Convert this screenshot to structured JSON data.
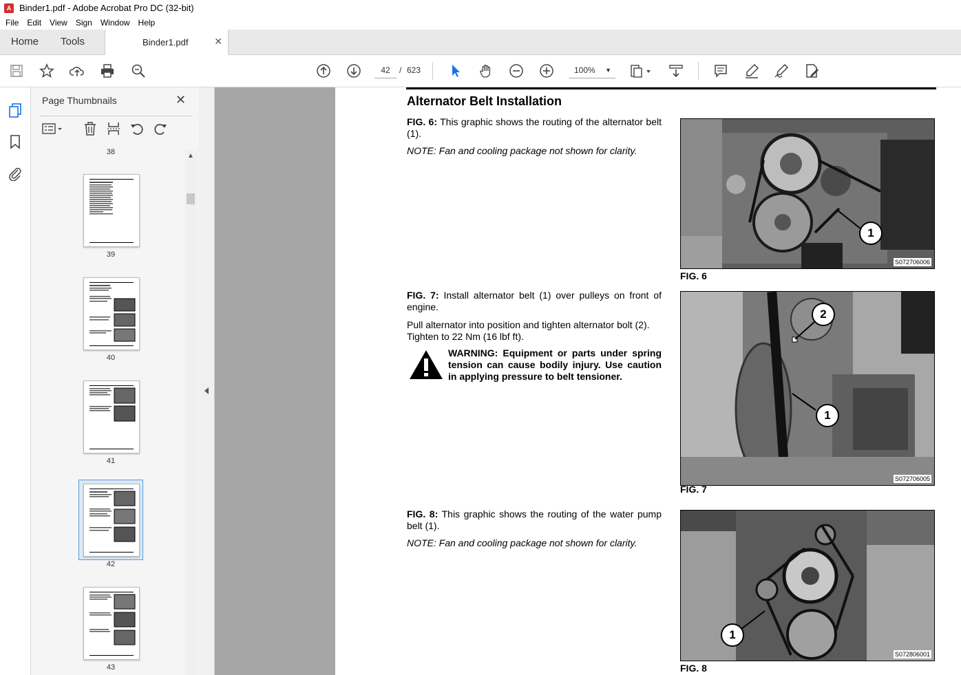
{
  "window": {
    "title": "Binder1.pdf - Adobe Acrobat Pro DC (32-bit)"
  },
  "menu": {
    "items": [
      "File",
      "Edit",
      "View",
      "Sign",
      "Window",
      "Help"
    ]
  },
  "tabs": {
    "home": "Home",
    "tools": "Tools",
    "document": "Binder1.pdf"
  },
  "toolbar": {
    "current_page": "42",
    "page_sep": "/",
    "total_pages": "623",
    "zoom": "100%"
  },
  "thumbnails": {
    "title": "Page Thumbnails",
    "partial_label": "38",
    "pages": [
      "39",
      "40",
      "41",
      "42",
      "43"
    ],
    "selected": "42"
  },
  "document": {
    "section_title": "Alternator Belt Installation",
    "fig6": {
      "ref": "FIG. 6:",
      "text": "This graphic shows the routing of the alternator belt (1).",
      "note": "NOTE:  Fan and cooling package not shown for clarity.",
      "code": "S072706006",
      "label": "FIG. 6",
      "callouts": [
        "1"
      ]
    },
    "fig7": {
      "ref": "FIG. 7:",
      "text": "Install alternator belt (1) over pulleys on front of engine.",
      "text2": "Pull alternator into position and tighten alternator bolt (2). Tighten to 22 Nm (16 lbf ft).",
      "code": "S072706005",
      "label": "FIG. 7",
      "callouts": [
        "2",
        "1"
      ]
    },
    "warning": "WARNING: Equipment or parts under spring tension can cause bodily injury. Use caution in applying pressure to belt tensioner.",
    "fig8": {
      "ref": "FIG. 8:",
      "text": "This graphic shows the routing of the water pump belt (1).",
      "note": "NOTE:  Fan and cooling package not shown for clarity.",
      "code": "S072806001",
      "label": "FIG. 8",
      "callouts": [
        "1"
      ]
    }
  }
}
